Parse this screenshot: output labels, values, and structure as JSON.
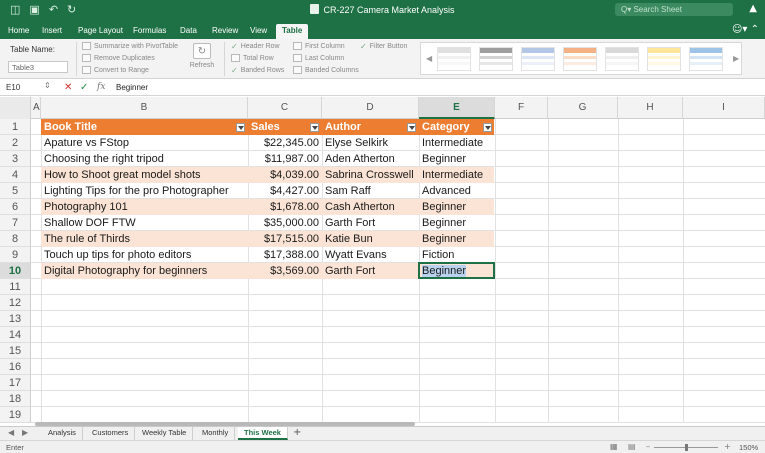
{
  "window": {
    "title": "CR-227 Camera Market Analysis",
    "search_placeholder": "Q▾ Search Sheet",
    "titlebar_icons": [
      "sidebar-icon",
      "save-icon",
      "undo-icon",
      "redo-icon"
    ]
  },
  "ribbon_tabs": [
    {
      "label": "Home"
    },
    {
      "label": "Insert"
    },
    {
      "label": "Page Layout"
    },
    {
      "label": "Formulas"
    },
    {
      "label": "Data"
    },
    {
      "label": "Review"
    },
    {
      "label": "View"
    },
    {
      "label": "Table",
      "active": true
    }
  ],
  "ribbon": {
    "table_name_label": "Table Name:",
    "table_name_value": "Table3",
    "tools": [
      "Summarize with PivotTable",
      "Remove Duplicates",
      "Convert to Range"
    ],
    "refresh_label": "Refresh",
    "options": [
      {
        "label": "Header Row",
        "checked": true
      },
      {
        "label": "Total Row",
        "checked": false
      },
      {
        "label": "Banded Rows",
        "checked": true
      },
      {
        "label": "First Column",
        "checked": false
      },
      {
        "label": "Last Column",
        "checked": false
      },
      {
        "label": "Banded Columns",
        "checked": false
      },
      {
        "label": "Filter Button",
        "checked": true
      }
    ],
    "style_colors": [
      "#e0e0e0",
      "#9e9e9e",
      "#b4c7e7",
      "#f4b183",
      "#d9d9d9",
      "#ffe699",
      "#9dc3e6"
    ]
  },
  "formula_bar": {
    "cell_ref": "E10",
    "fx_symbol": "fx",
    "value": "Beginner"
  },
  "columns": [
    "A",
    "B",
    "C",
    "D",
    "E",
    "F",
    "G",
    "H",
    "I"
  ],
  "selected_column": "E",
  "rows": [
    "1",
    "2",
    "3",
    "4",
    "5",
    "6",
    "7",
    "8",
    "9",
    "10",
    "11",
    "12",
    "13",
    "14",
    "15",
    "16",
    "17",
    "18",
    "19"
  ],
  "selected_row": "10",
  "table": {
    "headers": [
      "Book Title",
      "Sales",
      "Author",
      "Category"
    ],
    "rows": [
      [
        "Apature vs FStop",
        "$22,345.00",
        "Elyse Selkirk",
        "Intermediate"
      ],
      [
        "Choosing the right tripod",
        "$11,987.00",
        "Aden Atherton",
        "Beginner"
      ],
      [
        "How to Shoot great model shots",
        "$4,039.00",
        "Sabrina Crosswell",
        "Intermediate"
      ],
      [
        "Lighting Tips for the pro Photographer",
        "$4,427.00",
        "Sam Raff",
        "Advanced"
      ],
      [
        "Photography 101",
        "$1,678.00",
        "Cash Atherton",
        "Beginner"
      ],
      [
        "Shallow DOF FTW",
        "$35,000.00",
        "Garth Fort",
        "Beginner"
      ],
      [
        "The rule of Thirds",
        "$17,515.00",
        "Katie Bun",
        "Beginner"
      ],
      [
        "Touch up tips for photo editors",
        "$17,388.00",
        "Wyatt Evans",
        "Fiction"
      ],
      [
        "Digital Photography for beginners",
        "$3,569.00",
        "Garth Fort",
        "Beginner"
      ]
    ],
    "header_color": "#ed7d31",
    "band_color": "#fbe4d5"
  },
  "active_cell": {
    "ref": "E10",
    "value": "Beginner"
  },
  "sheet_tabs": [
    {
      "label": "Analysis"
    },
    {
      "label": "Customers"
    },
    {
      "label": "Weekly Table"
    },
    {
      "label": "Monthly"
    },
    {
      "label": "This Week",
      "active": true
    }
  ],
  "status": {
    "mode": "Enter",
    "zoom": "150%",
    "zoom_minus": "–",
    "zoom_plus": "+"
  },
  "colors": {
    "brand": "#1e7145"
  }
}
